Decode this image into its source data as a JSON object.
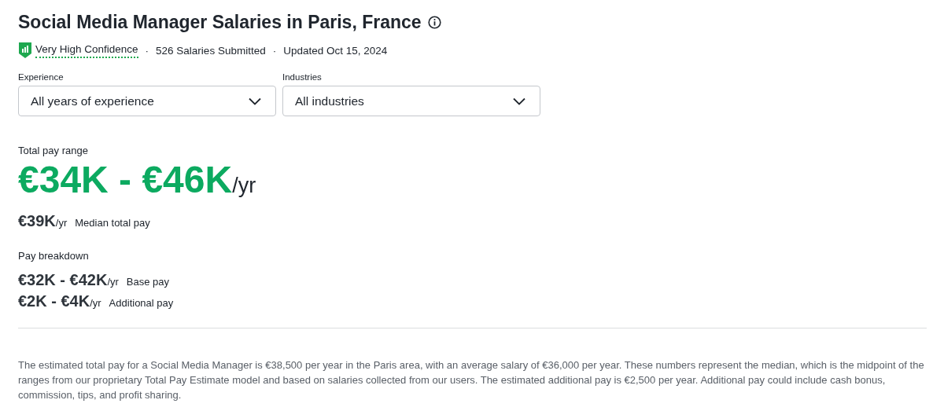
{
  "title": "Social Media Manager Salaries in Paris, France",
  "meta": {
    "confidence": "Very High Confidence",
    "items": [
      {
        "separator": "·",
        "text": "526 Salaries Submitted"
      },
      {
        "separator": "·",
        "text": "Updated Oct 15, 2024"
      }
    ]
  },
  "filters": [
    {
      "label": "Experience",
      "value": "All years of experience"
    },
    {
      "label": "Industries",
      "value": "All industries"
    }
  ],
  "total_pay": {
    "label": "Total pay range",
    "range": "€34K - €46K",
    "unit": "/yr",
    "median": "€39K",
    "median_unit": "/yr",
    "median_label": "Median total pay"
  },
  "breakdown": {
    "label": "Pay breakdown",
    "rows": [
      {
        "range": "€32K - €42K",
        "unit": "/yr",
        "label": "Base pay"
      },
      {
        "range": "€2K - €4K",
        "unit": "/yr",
        "label": "Additional pay"
      }
    ]
  },
  "description": "The estimated total pay for a Social Media Manager is €38,500 per year in the Paris area, with an average salary of €36,000 per year. These numbers represent the median, which is the midpoint of the ranges from our proprietary Total Pay Estimate model and based on salaries collected from our users. The estimated additional pay is €2,500 per year. Additional pay could include cash bonus, commission, tips, and profit sharing."
}
